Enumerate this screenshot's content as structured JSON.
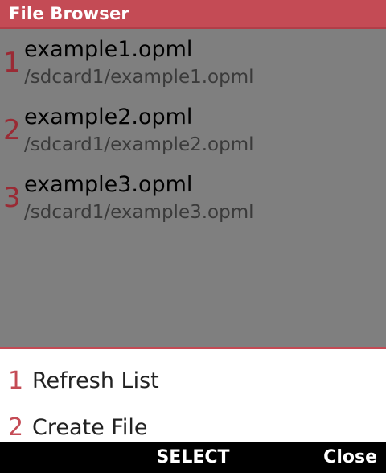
{
  "header": {
    "title": "File Browser"
  },
  "files": [
    {
      "index": "1",
      "name": "example1.opml",
      "path": "/sdcard1/example1.opml"
    },
    {
      "index": "2",
      "name": "example2.opml",
      "path": "/sdcard1/example2.opml"
    },
    {
      "index": "3",
      "name": "example3.opml",
      "path": "/sdcard1/example3.opml"
    }
  ],
  "menu": [
    {
      "index": "1",
      "label": "Refresh List"
    },
    {
      "index": "2",
      "label": "Create File"
    }
  ],
  "softkeys": {
    "center": "SELECT",
    "right": "Close"
  },
  "colors": {
    "accent": "#c44b55",
    "list_bg": "#7f7f7f",
    "softkey_bg": "#000000"
  }
}
